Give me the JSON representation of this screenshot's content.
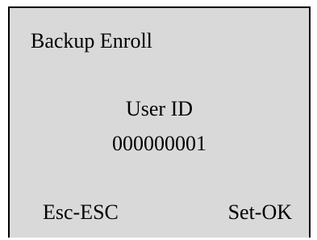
{
  "screen": {
    "title": "Backup Enroll",
    "field_label": "User ID",
    "field_value": "000000001",
    "soft_keys": {
      "left": "Esc-ESC",
      "right": "Set-OK"
    }
  },
  "colors": {
    "background": "#d9d9d9",
    "text": "#000000",
    "border": "#000000"
  }
}
